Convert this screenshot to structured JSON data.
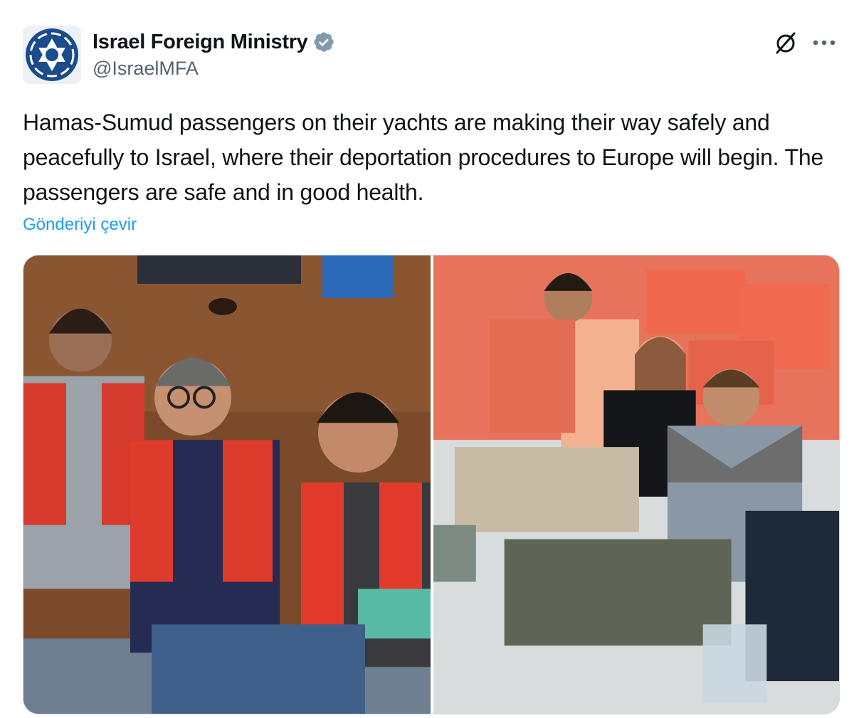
{
  "author": {
    "display_name": "Israel Foreign Ministry",
    "handle": "@IsraelMFA",
    "verified_icon": "verified-badge-icon",
    "avatar_icon": "star-of-david-logo"
  },
  "tweet": {
    "text": "Hamas-Sumud passengers on their yachts are making their way safely and peacefully to Israel, where their deportation procedures to Europe will begin. The passengers are safe and in good health.",
    "translate_link": "Gönderiyi çevir"
  },
  "actions": {
    "grok_icon": "grok-icon",
    "more_icon": "more-dots-icon"
  },
  "media": {
    "count": 2
  },
  "colors": {
    "accent": "#1d9bf0",
    "secondary_text": "#536471",
    "verified_gray": "#829aab",
    "logo_blue": "#1a4b8c"
  }
}
